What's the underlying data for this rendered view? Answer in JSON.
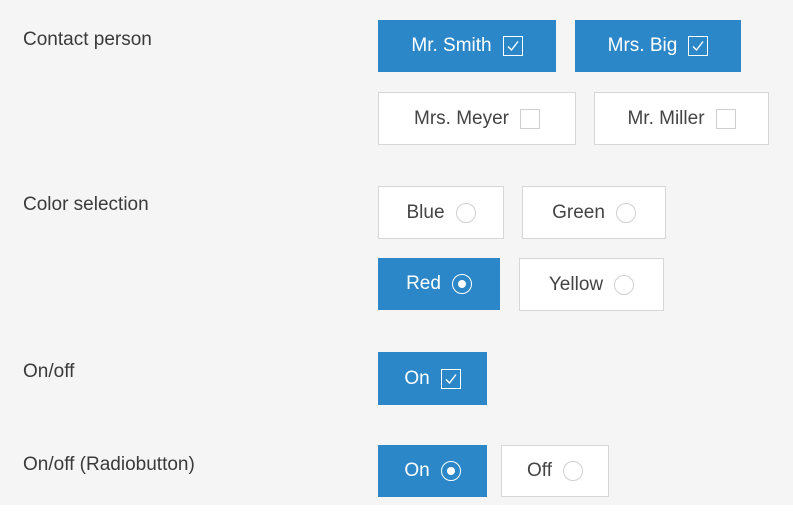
{
  "contact_person": {
    "label": "Contact person",
    "options": [
      {
        "label": "Mr. Smith",
        "checked": true
      },
      {
        "label": "Mrs. Big",
        "checked": true
      },
      {
        "label": "Mrs. Meyer",
        "checked": false
      },
      {
        "label": "Mr. Miller",
        "checked": false
      }
    ]
  },
  "color_selection": {
    "label": "Color selection",
    "options": [
      {
        "label": "Blue",
        "selected": false
      },
      {
        "label": "Green",
        "selected": false
      },
      {
        "label": "Red",
        "selected": true
      },
      {
        "label": "Yellow",
        "selected": false
      }
    ]
  },
  "on_off": {
    "label": "On/off",
    "toggle_label": "On",
    "checked": true
  },
  "on_off_radio": {
    "label": "On/off (Radiobutton)",
    "options": [
      {
        "label": "On",
        "selected": true
      },
      {
        "label": "Off",
        "selected": false
      }
    ]
  },
  "colors": {
    "accent": "#2b87c8",
    "panel_bg": "#f5f5f5",
    "border": "#d6d6d6"
  }
}
